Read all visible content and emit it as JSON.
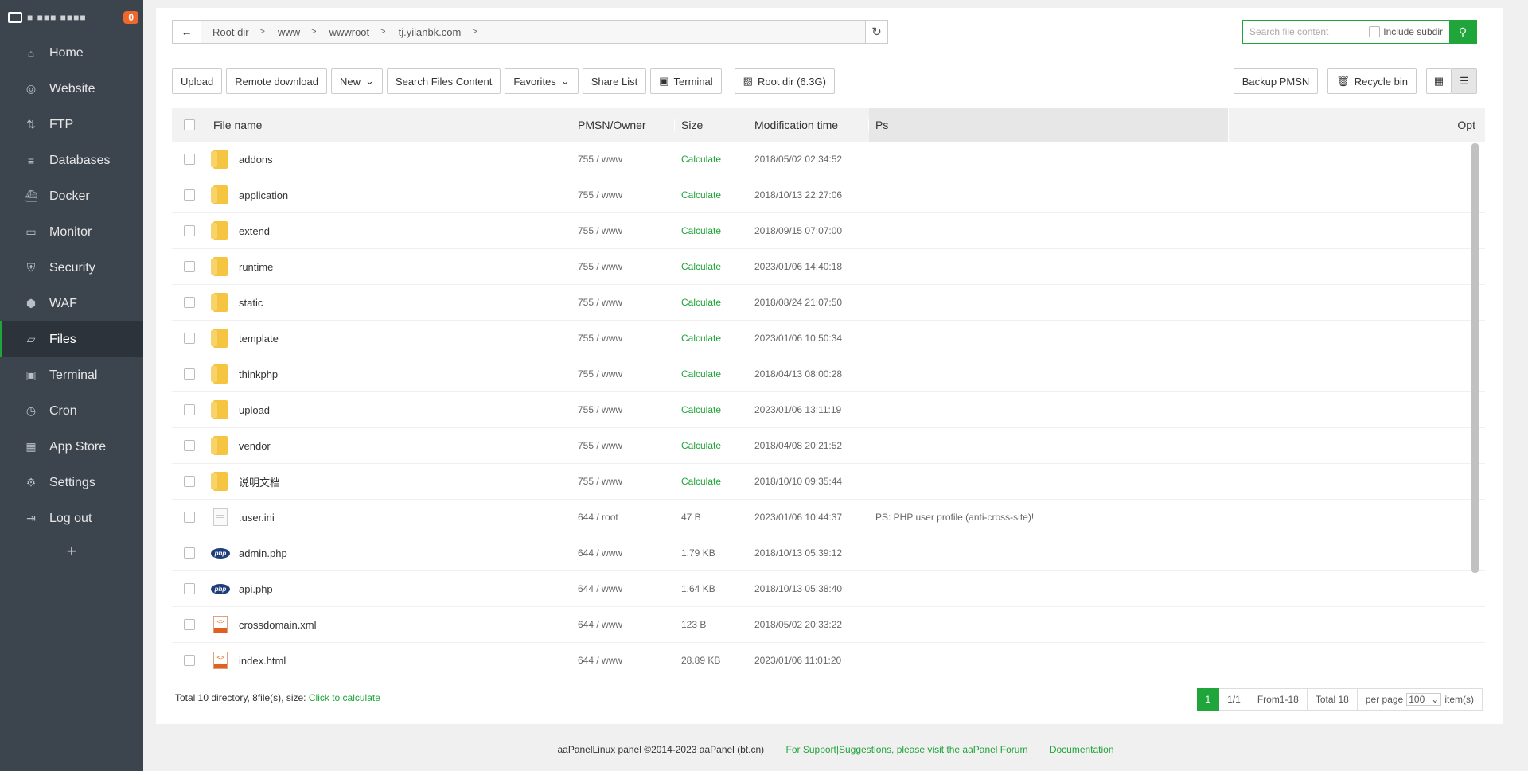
{
  "sidebar": {
    "ip": "■ ■■■ ■■■■",
    "badge": "0",
    "items": [
      {
        "label": "Home",
        "icon": "home-icon",
        "glyph": "⌂"
      },
      {
        "label": "Website",
        "icon": "globe-icon",
        "glyph": "◎"
      },
      {
        "label": "FTP",
        "icon": "ftp-icon",
        "glyph": "⇅"
      },
      {
        "label": "Databases",
        "icon": "database-icon",
        "glyph": "≡"
      },
      {
        "label": "Docker",
        "icon": "docker-icon",
        "glyph": "⛴"
      },
      {
        "label": "Monitor",
        "icon": "monitor-icon",
        "glyph": "▭"
      },
      {
        "label": "Security",
        "icon": "shield-icon",
        "glyph": "⛨"
      },
      {
        "label": "WAF",
        "icon": "waf-icon",
        "glyph": "⬢"
      },
      {
        "label": "Files",
        "icon": "folder-icon",
        "glyph": "▱"
      },
      {
        "label": "Terminal",
        "icon": "terminal-icon",
        "glyph": "▣"
      },
      {
        "label": "Cron",
        "icon": "clock-icon",
        "glyph": "◷"
      },
      {
        "label": "App Store",
        "icon": "grid-icon",
        "glyph": "▦"
      },
      {
        "label": "Settings",
        "icon": "gear-icon",
        "glyph": "⚙"
      },
      {
        "label": "Log out",
        "icon": "logout-icon",
        "glyph": "⇥"
      }
    ],
    "active": "Files",
    "plus": "+"
  },
  "path": {
    "crumbs": [
      "Root dir",
      "www",
      "wwwroot",
      "tj.yilanbk.com"
    ]
  },
  "search": {
    "placeholder": "Search file content",
    "include_subdir": "Include subdir"
  },
  "toolbar": {
    "upload": "Upload",
    "remote_download": "Remote download",
    "new": "New",
    "search_files_content": "Search Files Content",
    "favorites": "Favorites",
    "share_list": "Share List",
    "terminal": "Terminal",
    "root_dir": "Root dir (6.3G)",
    "backup_pmsn": "Backup PMSN",
    "recycle_bin": "Recycle bin"
  },
  "table": {
    "headers": {
      "name": "File name",
      "perm": "PMSN/Owner",
      "size": "Size",
      "time": "Modification time",
      "ps": "Ps",
      "opt": "Opt"
    },
    "rows": [
      {
        "type": "folder",
        "name": "addons",
        "perm": "755 / www",
        "size": "Calculate",
        "time": "2018/05/02 02:34:52",
        "ps": ""
      },
      {
        "type": "folder",
        "name": "application",
        "perm": "755 / www",
        "size": "Calculate",
        "time": "2018/10/13 22:27:06",
        "ps": ""
      },
      {
        "type": "folder",
        "name": "extend",
        "perm": "755 / www",
        "size": "Calculate",
        "time": "2018/09/15 07:07:00",
        "ps": ""
      },
      {
        "type": "folder",
        "name": "runtime",
        "perm": "755 / www",
        "size": "Calculate",
        "time": "2023/01/06 14:40:18",
        "ps": ""
      },
      {
        "type": "folder",
        "name": "static",
        "perm": "755 / www",
        "size": "Calculate",
        "time": "2018/08/24 21:07:50",
        "ps": ""
      },
      {
        "type": "folder",
        "name": "template",
        "perm": "755 / www",
        "size": "Calculate",
        "time": "2023/01/06 10:50:34",
        "ps": ""
      },
      {
        "type": "folder",
        "name": "thinkphp",
        "perm": "755 / www",
        "size": "Calculate",
        "time": "2018/04/13 08:00:28",
        "ps": ""
      },
      {
        "type": "folder",
        "name": "upload",
        "perm": "755 / www",
        "size": "Calculate",
        "time": "2023/01/06 13:11:19",
        "ps": ""
      },
      {
        "type": "folder",
        "name": "vendor",
        "perm": "755 / www",
        "size": "Calculate",
        "time": "2018/04/08 20:21:52",
        "ps": ""
      },
      {
        "type": "folder",
        "name": "说明文档",
        "perm": "755 / www",
        "size": "Calculate",
        "time": "2018/10/10 09:35:44",
        "ps": ""
      },
      {
        "type": "file",
        "name": ".user.ini",
        "perm": "644 / root",
        "size": "47 B",
        "time": "2023/01/06 10:44:37",
        "ps": "PS: PHP user profile (anti-cross-site)!"
      },
      {
        "type": "php",
        "name": "admin.php",
        "perm": "644 / www",
        "size": "1.79 KB",
        "time": "2018/10/13 05:39:12",
        "ps": ""
      },
      {
        "type": "php",
        "name": "api.php",
        "perm": "644 / www",
        "size": "1.64 KB",
        "time": "2018/10/13 05:38:40",
        "ps": ""
      },
      {
        "type": "xml",
        "name": "crossdomain.xml",
        "perm": "644 / www",
        "size": "123 B",
        "time": "2018/05/02 20:33:22",
        "ps": ""
      },
      {
        "type": "html",
        "name": "index.html",
        "perm": "644 / www",
        "size": "28.89 KB",
        "time": "2023/01/06 11:01:20",
        "ps": ""
      }
    ]
  },
  "stats": {
    "text": "Total 10 directory, 8file(s), size:",
    "link": "Click to calculate"
  },
  "pager": {
    "current": "1",
    "pages": "1/1",
    "range": "From1-18",
    "total": "Total 18",
    "per_page": "per page",
    "per_page_value": "100",
    "unit": "item(s)"
  },
  "footer": {
    "copyright": "aaPanelLinux panel ©2014-2023 aaPanel (bt.cn)",
    "support": "For Support|Suggestions, please visit the aaPanel Forum",
    "docs": "Documentation"
  },
  "colors": {
    "accent": "#20a53a",
    "sidebar": "#3c444d",
    "badge": "#f0662b"
  }
}
